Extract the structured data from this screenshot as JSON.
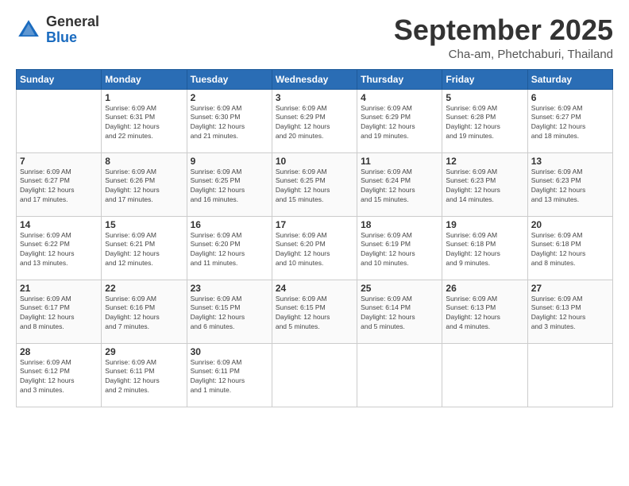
{
  "header": {
    "logo_general": "General",
    "logo_blue": "Blue",
    "month_title": "September 2025",
    "location": "Cha-am, Phetchaburi, Thailand"
  },
  "days_of_week": [
    "Sunday",
    "Monday",
    "Tuesday",
    "Wednesday",
    "Thursday",
    "Friday",
    "Saturday"
  ],
  "weeks": [
    [
      {
        "num": "",
        "info": ""
      },
      {
        "num": "1",
        "info": "Sunrise: 6:09 AM\nSunset: 6:31 PM\nDaylight: 12 hours\nand 22 minutes."
      },
      {
        "num": "2",
        "info": "Sunrise: 6:09 AM\nSunset: 6:30 PM\nDaylight: 12 hours\nand 21 minutes."
      },
      {
        "num": "3",
        "info": "Sunrise: 6:09 AM\nSunset: 6:29 PM\nDaylight: 12 hours\nand 20 minutes."
      },
      {
        "num": "4",
        "info": "Sunrise: 6:09 AM\nSunset: 6:29 PM\nDaylight: 12 hours\nand 19 minutes."
      },
      {
        "num": "5",
        "info": "Sunrise: 6:09 AM\nSunset: 6:28 PM\nDaylight: 12 hours\nand 19 minutes."
      },
      {
        "num": "6",
        "info": "Sunrise: 6:09 AM\nSunset: 6:27 PM\nDaylight: 12 hours\nand 18 minutes."
      }
    ],
    [
      {
        "num": "7",
        "info": "Sunrise: 6:09 AM\nSunset: 6:27 PM\nDaylight: 12 hours\nand 17 minutes."
      },
      {
        "num": "8",
        "info": "Sunrise: 6:09 AM\nSunset: 6:26 PM\nDaylight: 12 hours\nand 17 minutes."
      },
      {
        "num": "9",
        "info": "Sunrise: 6:09 AM\nSunset: 6:25 PM\nDaylight: 12 hours\nand 16 minutes."
      },
      {
        "num": "10",
        "info": "Sunrise: 6:09 AM\nSunset: 6:25 PM\nDaylight: 12 hours\nand 15 minutes."
      },
      {
        "num": "11",
        "info": "Sunrise: 6:09 AM\nSunset: 6:24 PM\nDaylight: 12 hours\nand 15 minutes."
      },
      {
        "num": "12",
        "info": "Sunrise: 6:09 AM\nSunset: 6:23 PM\nDaylight: 12 hours\nand 14 minutes."
      },
      {
        "num": "13",
        "info": "Sunrise: 6:09 AM\nSunset: 6:23 PM\nDaylight: 12 hours\nand 13 minutes."
      }
    ],
    [
      {
        "num": "14",
        "info": "Sunrise: 6:09 AM\nSunset: 6:22 PM\nDaylight: 12 hours\nand 13 minutes."
      },
      {
        "num": "15",
        "info": "Sunrise: 6:09 AM\nSunset: 6:21 PM\nDaylight: 12 hours\nand 12 minutes."
      },
      {
        "num": "16",
        "info": "Sunrise: 6:09 AM\nSunset: 6:20 PM\nDaylight: 12 hours\nand 11 minutes."
      },
      {
        "num": "17",
        "info": "Sunrise: 6:09 AM\nSunset: 6:20 PM\nDaylight: 12 hours\nand 10 minutes."
      },
      {
        "num": "18",
        "info": "Sunrise: 6:09 AM\nSunset: 6:19 PM\nDaylight: 12 hours\nand 10 minutes."
      },
      {
        "num": "19",
        "info": "Sunrise: 6:09 AM\nSunset: 6:18 PM\nDaylight: 12 hours\nand 9 minutes."
      },
      {
        "num": "20",
        "info": "Sunrise: 6:09 AM\nSunset: 6:18 PM\nDaylight: 12 hours\nand 8 minutes."
      }
    ],
    [
      {
        "num": "21",
        "info": "Sunrise: 6:09 AM\nSunset: 6:17 PM\nDaylight: 12 hours\nand 8 minutes."
      },
      {
        "num": "22",
        "info": "Sunrise: 6:09 AM\nSunset: 6:16 PM\nDaylight: 12 hours\nand 7 minutes."
      },
      {
        "num": "23",
        "info": "Sunrise: 6:09 AM\nSunset: 6:15 PM\nDaylight: 12 hours\nand 6 minutes."
      },
      {
        "num": "24",
        "info": "Sunrise: 6:09 AM\nSunset: 6:15 PM\nDaylight: 12 hours\nand 5 minutes."
      },
      {
        "num": "25",
        "info": "Sunrise: 6:09 AM\nSunset: 6:14 PM\nDaylight: 12 hours\nand 5 minutes."
      },
      {
        "num": "26",
        "info": "Sunrise: 6:09 AM\nSunset: 6:13 PM\nDaylight: 12 hours\nand 4 minutes."
      },
      {
        "num": "27",
        "info": "Sunrise: 6:09 AM\nSunset: 6:13 PM\nDaylight: 12 hours\nand 3 minutes."
      }
    ],
    [
      {
        "num": "28",
        "info": "Sunrise: 6:09 AM\nSunset: 6:12 PM\nDaylight: 12 hours\nand 3 minutes."
      },
      {
        "num": "29",
        "info": "Sunrise: 6:09 AM\nSunset: 6:11 PM\nDaylight: 12 hours\nand 2 minutes."
      },
      {
        "num": "30",
        "info": "Sunrise: 6:09 AM\nSunset: 6:11 PM\nDaylight: 12 hours\nand 1 minute."
      },
      {
        "num": "",
        "info": ""
      },
      {
        "num": "",
        "info": ""
      },
      {
        "num": "",
        "info": ""
      },
      {
        "num": "",
        "info": ""
      }
    ]
  ]
}
